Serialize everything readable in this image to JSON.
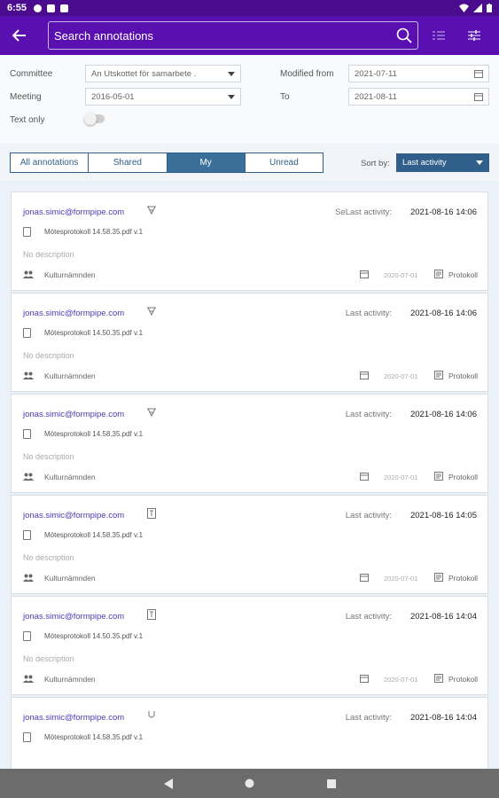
{
  "status_bar": {
    "time": "6:55"
  },
  "search": {
    "placeholder": "Search annotations"
  },
  "filters": {
    "committee_label": "Committee",
    "committee_value": "An Utskottet för samarbete .",
    "meeting_label": "Meeting",
    "meeting_value": "2016-05-01",
    "text_only_label": "Text only",
    "text_only": false,
    "modified_from_label": "Modified from",
    "modified_from_value": "2021-07-11",
    "to_label": "To",
    "to_value": "2021-08-11"
  },
  "tabs": [
    {
      "label": "All annotations"
    },
    {
      "label": "Shared"
    },
    {
      "label": "My"
    },
    {
      "label": "Unread"
    }
  ],
  "active_tab": "My",
  "sort": {
    "label": "Sort by:",
    "value": "Last activity"
  },
  "annotations": [
    {
      "user": "jonas.simic@formpipe.com",
      "type_icon": "highlight-icon",
      "last_activity_label": "SeLast activity:",
      "last_activity": "2021-08-16 14:06",
      "file": "Mötesprotokoll 14.58.35.pdf v.1",
      "description": "No description",
      "group": "Kulturnämnden",
      "meeting_date": "2020-07-01",
      "doc_type": "Protokoll"
    },
    {
      "user": "jonas.simic@formpipe.com",
      "type_icon": "highlight-icon",
      "last_activity_label": "Last activity:",
      "last_activity": "2021-08-16 14:06",
      "file": "Mötesprotokoll 14.50.35.pdf v.1",
      "description": "No description",
      "group": "Kulturnämnden",
      "meeting_date": "2020-07-01",
      "doc_type": "Protokoll"
    },
    {
      "user": "jonas.simic@formpipe.com",
      "type_icon": "highlight-icon",
      "last_activity_label": "Last activity:",
      "last_activity": "2021-08-16 14:06",
      "file": "Mötesprotokoll 14.58.35.pdf v.1",
      "description": "No description",
      "group": "Kulturnämnden",
      "meeting_date": "2020-07-01",
      "doc_type": "Protokoll"
    },
    {
      "user": "jonas.simic@formpipe.com",
      "type_icon": "text-note-icon",
      "last_activity_label": "Last activity:",
      "last_activity": "2021-08-16 14:05",
      "file": "Mötesprotokoll 14.58.35.pdf v.1",
      "description": "No description",
      "group": "Kulturnämnden",
      "meeting_date": "2020-07-01",
      "doc_type": "Protokoll"
    },
    {
      "user": "jonas.simic@formpipe.com",
      "type_icon": "text-note-icon",
      "last_activity_label": "Last activity:",
      "last_activity": "2021-08-16 14:04",
      "file": "Mötesprotokoll 14.50.35.pdf v.1",
      "description": "No description",
      "group": "Kulturnämnden",
      "meeting_date": "2020-07-01",
      "doc_type": "Protokoll"
    },
    {
      "user": "jonas.simic@formpipe.com",
      "type_icon": "underline-icon",
      "last_activity_label": "Last activity:",
      "last_activity": "2021-08-16 14:04",
      "file": "Mötesprotokoll 14.58.35.pdf v.1",
      "description": "",
      "group": "",
      "meeting_date": "",
      "doc_type": ""
    }
  ]
}
